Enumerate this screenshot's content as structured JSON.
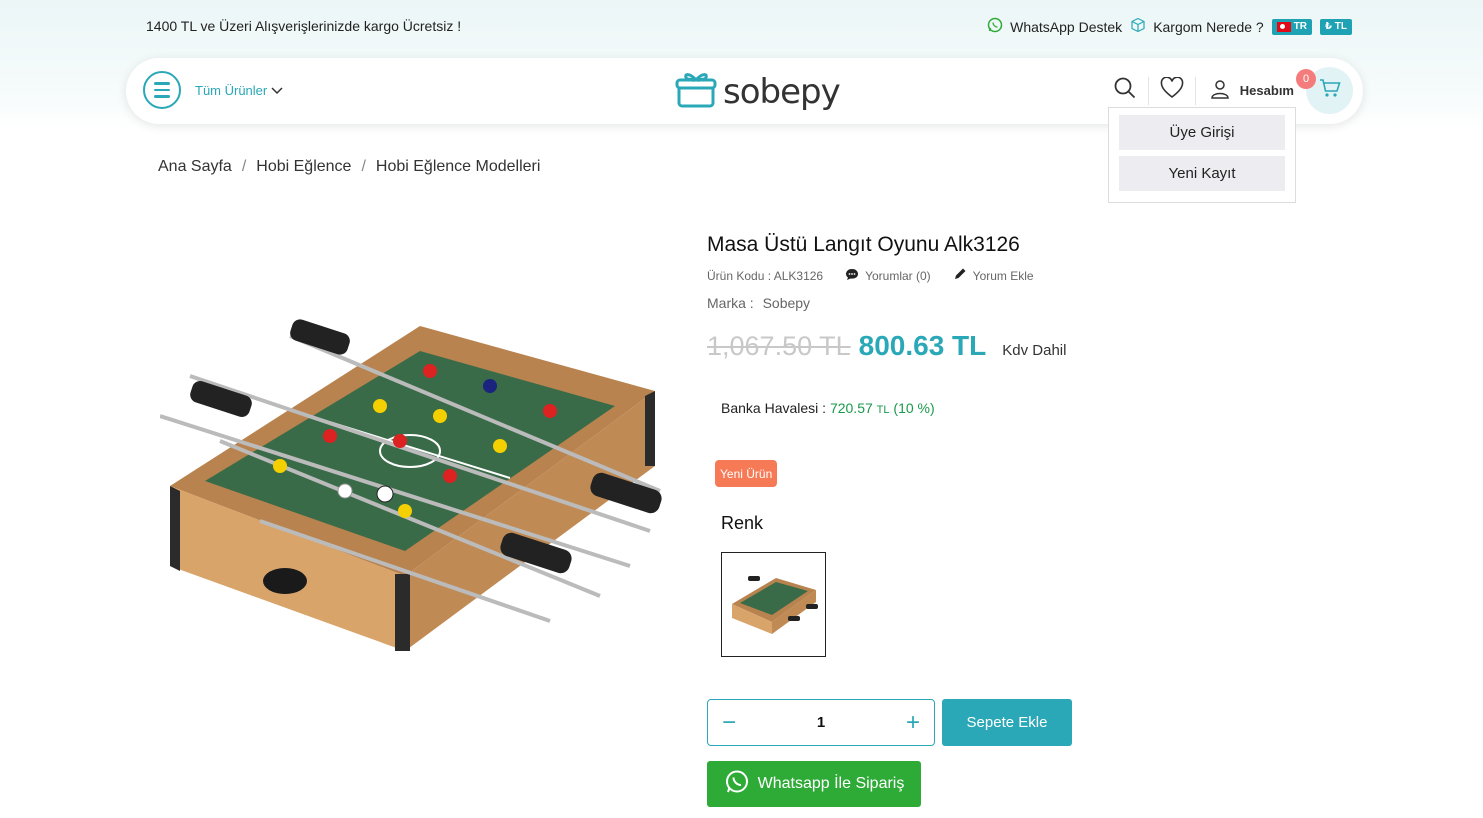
{
  "topbar": {
    "promo": "1400 TL ve Üzeri Alışverişlerinizde kargo Ücretsiz !",
    "whatsapp": "WhatsApp Destek",
    "cargo": "Kargom Nerede ?",
    "lang": "TR",
    "currency": "₺ TL"
  },
  "nav": {
    "all_products": "Tüm Ürünler",
    "logo": "sobepy",
    "account": "Hesabım",
    "cart_count": "0"
  },
  "account_menu": {
    "login": "Üye Girişi",
    "register": "Yeni Kayıt"
  },
  "breadcrumb": [
    "Ana Sayfa",
    "Hobi Eğlence",
    "Hobi Eğlence Modelleri"
  ],
  "product": {
    "title": "Masa Üstü Langıt Oyunu Alk3126",
    "code": "Ürün Kodu : ALK3126",
    "reviews": "Yorumlar (0)",
    "add_review": "Yorum Ekle",
    "brand_label": "Marka :",
    "brand": "Sobepy",
    "old_price": "1,067.50 TL",
    "price": "800.63 TL",
    "vat": "Kdv Dahil",
    "bank_label": "Banka Havalesi :",
    "bank_price_main": "720.57",
    "bank_price_cur": "TL",
    "bank_pct": "(10 %)",
    "new_tag": "Yeni Ürün",
    "color_label": "Renk",
    "quantity": "1",
    "add_to_cart": "Sepete Ekle",
    "whatsapp_order": "Whatsapp İle Sipariş"
  },
  "colors": {
    "accent": "#2aa8b8",
    "new_tag": "#f77a56",
    "whatsapp": "#2eaa37"
  }
}
